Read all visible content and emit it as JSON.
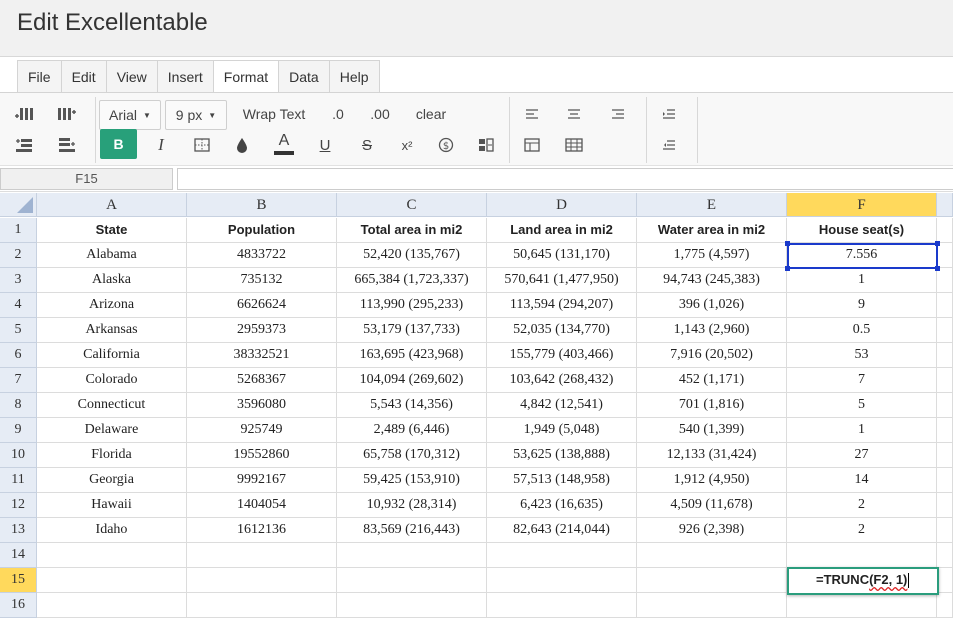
{
  "app": {
    "title": "Edit Excellentable"
  },
  "menus": [
    "File",
    "Edit",
    "View",
    "Insert",
    "Format",
    "Data",
    "Help"
  ],
  "active_menu": "Format",
  "toolbar": {
    "font": "Arial",
    "font_size": "9 px",
    "wrap_text": "Wrap Text",
    "decrease_decimal": ".0",
    "increase_decimal": ".00",
    "clear": "clear",
    "bold": "B",
    "italic": "I",
    "text_color": "A",
    "underline": "U",
    "strikethrough": "S",
    "superscript": "x²"
  },
  "name_box": "F15",
  "formula_bar": "",
  "columns": [
    "A",
    "B",
    "C",
    "D",
    "E",
    "F"
  ],
  "rows": [
    "1",
    "2",
    "3",
    "4",
    "5",
    "6",
    "7",
    "8",
    "9",
    "10",
    "11",
    "12",
    "13",
    "14",
    "15",
    "16"
  ],
  "headers": [
    "State",
    "Population",
    "Total area in mi2",
    "Land area in mi2",
    "Water area in mi2",
    "House seat(s)"
  ],
  "data_rows": [
    [
      "Alabama",
      "4833722",
      "52,420 (135,767)",
      "50,645 (131,170)",
      "1,775 (4,597)",
      "7.556"
    ],
    [
      "Alaska",
      "735132",
      "665,384 (1,723,337)",
      "570,641 (1,477,950)",
      "94,743 (245,383)",
      "1"
    ],
    [
      "Arizona",
      "6626624",
      "113,990 (295,233)",
      "113,594 (294,207)",
      "396 (1,026)",
      "9"
    ],
    [
      "Arkansas",
      "2959373",
      "53,179 (137,733)",
      "52,035 (134,770)",
      "1,143 (2,960)",
      "0.5"
    ],
    [
      "California",
      "38332521",
      "163,695 (423,968)",
      "155,779 (403,466)",
      "7,916 (20,502)",
      "53"
    ],
    [
      "Colorado",
      "5268367",
      "104,094 (269,602)",
      "103,642 (268,432)",
      "452 (1,171)",
      "7"
    ],
    [
      "Connecticut",
      "3596080",
      "5,543 (14,356)",
      "4,842 (12,541)",
      "701 (1,816)",
      "5"
    ],
    [
      "Delaware",
      "925749",
      "2,489 (6,446)",
      "1,949 (5,048)",
      "540 (1,399)",
      "1"
    ],
    [
      "Florida",
      "19552860",
      "65,758 (170,312)",
      "53,625 (138,888)",
      "12,133 (31,424)",
      "27"
    ],
    [
      "Georgia",
      "9992167",
      "59,425 (153,910)",
      "57,513 (148,958)",
      "1,912 (4,950)",
      "14"
    ],
    [
      "Hawaii",
      "1404054",
      "10,932 (28,314)",
      "6,423 (16,635)",
      "4,509 (11,678)",
      "2"
    ],
    [
      "Idaho",
      "1612136",
      "83,569 (216,443)",
      "82,643 (214,044)",
      "926 (2,398)",
      "2"
    ]
  ],
  "editor": {
    "fn": "=TRUNC",
    "args": "(F2, 1)"
  },
  "colors": {
    "accent": "#28a07a",
    "selection": "#1a3acb",
    "active_header": "#ffd95c",
    "header_bg": "#e6ecf5"
  }
}
